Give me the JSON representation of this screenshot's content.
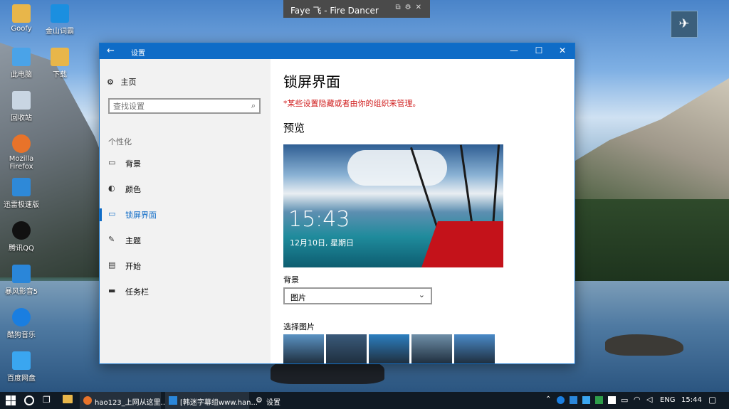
{
  "desktop": {
    "icons": [
      {
        "label": "Goofy",
        "icon": "folder-icon",
        "color": "#e8b64a"
      },
      {
        "label": "金山词霸",
        "icon": "dictionary-icon",
        "color": "#1b8fe0"
      },
      {
        "label": "此电脑",
        "icon": "computer-icon",
        "color": "#4aa3e8"
      },
      {
        "label": "下载",
        "icon": "folder-icon",
        "color": "#e8b64a"
      },
      {
        "label": "回收站",
        "icon": "recycle-bin-icon",
        "color": "#c9d6e3"
      },
      {
        "label": "Mozilla Firefox",
        "icon": "firefox-icon",
        "color": "#e8732a"
      },
      {
        "label": "迅雷极速版",
        "icon": "thunder-icon",
        "color": "#2e89d8"
      },
      {
        "label": "腾讯QQ",
        "icon": "qq-icon",
        "color": "#111111"
      },
      {
        "label": "暴风影音5",
        "icon": "media-player-icon",
        "color": "#2a86d9"
      },
      {
        "label": "酷狗音乐",
        "icon": "kugou-icon",
        "color": "#1a7ee0"
      },
      {
        "label": "百度网盘",
        "icon": "cloud-disk-icon",
        "color": "#3aa6f0"
      }
    ]
  },
  "widget": {
    "title": "Faye 飞 - Fire Dancer"
  },
  "window": {
    "title": "设置",
    "back_glyph": "←",
    "minimize_glyph": "—",
    "maximize_glyph": "☐",
    "close_glyph": "✕",
    "home_label": "主页",
    "search_placeholder": "查找设置",
    "section_label": "个性化",
    "nav": [
      {
        "label": "背景",
        "icon": "background-icon",
        "glyph": "▭"
      },
      {
        "label": "颜色",
        "icon": "palette-icon",
        "glyph": "◐"
      },
      {
        "label": "锁屏界面",
        "icon": "lock-screen-icon",
        "glyph": "▭",
        "active": true
      },
      {
        "label": "主题",
        "icon": "theme-icon",
        "glyph": "✎"
      },
      {
        "label": "开始",
        "icon": "start-icon",
        "glyph": "▤"
      },
      {
        "label": "任务栏",
        "icon": "taskbar-icon",
        "glyph": "▬"
      }
    ],
    "page_title": "锁屏界面",
    "warning": "*某些设置隐藏或者由你的组织来管理。",
    "preview_heading": "预览",
    "preview_time": "15:43",
    "preview_date": "12月10日, 星期日",
    "background_label": "背景",
    "background_value": "图片",
    "choose_picture_label": "选择图片",
    "thumbnails": [
      "#5b93c4",
      "#3a5a7a",
      "#2c7fc0",
      "#6f8fa8",
      "#4a8ac8"
    ]
  },
  "taskbar": {
    "tasks": [
      {
        "label": "hao123_上网从这里...",
        "icon": "firefox-icon"
      },
      {
        "label": "[韩迷字幕组www.han...",
        "icon": "media-player-icon"
      },
      {
        "label": "设置",
        "icon": "gear-icon"
      }
    ],
    "language": "ENG",
    "clock": "15:44"
  },
  "colors": {
    "accent": "#0f6cc7",
    "taskbar": "#101a24",
    "warning": "#d01f1f"
  }
}
